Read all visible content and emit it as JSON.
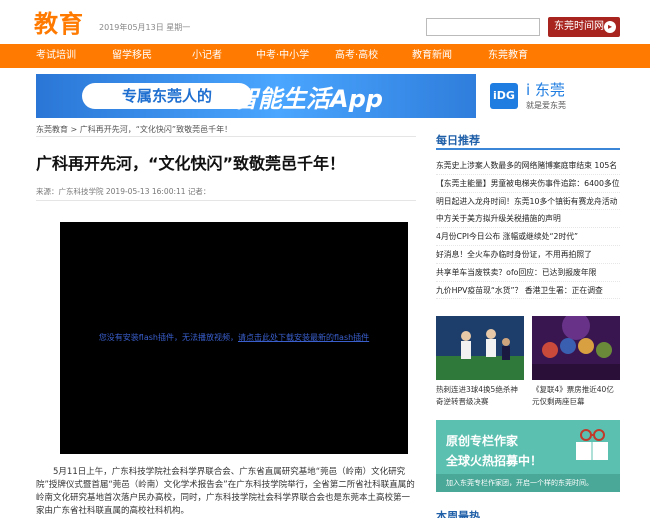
{
  "header": {
    "logo": "教育",
    "date": "2019年05月13日 星期一",
    "search_placeholder": "",
    "city_button": "东莞时间网",
    "city_arrow": "▸"
  },
  "nav": {
    "items": [
      "考试培训",
      "留学移民",
      "小记者",
      "中考·中小学",
      "高考·高校",
      "教育新闻",
      "东莞教育"
    ]
  },
  "banner": {
    "pill_text": "专属东莞人的",
    "slogan": "智能生活App",
    "icon_text": "iDG",
    "brand": "i 东莞",
    "tagline": "就是爱东莞"
  },
  "breadcrumb": "东莞教育 > 广科再开先河，“文化快闪”致敬莞邑千年！",
  "article": {
    "title": "广科再开先河，“文化快闪”致敬莞邑千年！",
    "meta": "来源：广东科技学院  2019-05-13 16:00:11  记者：",
    "video_msg": "您没有安装flash插件，无法播放视频，",
    "video_link": "请点击此处下载安装最新的flash插件",
    "body": "5月11日上午，广东科技学院社会科学界联合会、广东省直属研究基地“莞邑（岭南）文化研究院”授牌仪式暨首届“莞邑（岭南）文化学术报告会”在广东科技学院举行，全省第二所省社科联直属的岭南文化研究基地首次落户民办高校，同时，广东科技学院社会科学界联合会也是东莞本土高校第一家由广东省社科联直属的高校社科机构。"
  },
  "sidebar": {
    "title": "每日推荐",
    "news": [
      "东莞史上涉案人数最多的网络赌博案庭审结束 105名",
      "【东莞主能量】男童被电梯夹伤事件追踪：6400多位",
      "明日起进入龙舟时间！东莞10多个镇街有赛龙舟活动",
      "中方关于美方拟升级关税措施的声明",
      "4月份CPI今日公布 涨幅或继续处“2时代”",
      "好消息！全火车办临时身份证，不用再拍照了",
      "共享单车当废铁卖？ofo回应：已达到报废年限",
      "九价HPV疫苗现“水货”？ 香港卫生署：正在调查"
    ],
    "thumbs": [
      {
        "caption": "热刺连进3球4换5绝杀神奇逆转晋级决赛"
      },
      {
        "caption": "《复联4》票房推近40亿元仅剩两座巨幕"
      }
    ],
    "promo": {
      "line1": "原创专栏作家",
      "line2": "全球火热招募中！",
      "sub": "加入东莞专栏作家团，开启一个样的东莞时间。"
    },
    "title2": "本周最热"
  },
  "colors": {
    "brand_orange": "#ff7a00",
    "city_red": "#a8241e",
    "sidebar_blue": "#1f5fa8"
  }
}
